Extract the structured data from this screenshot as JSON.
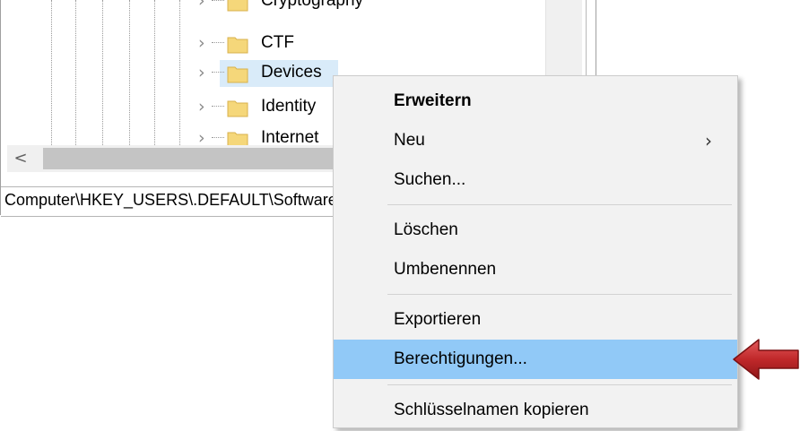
{
  "tree": {
    "items": [
      {
        "label": "Cryptography",
        "selected": false
      },
      {
        "label": "CTF",
        "selected": false
      },
      {
        "label": "Devices",
        "selected": true
      },
      {
        "label": "Identity",
        "selected": false
      },
      {
        "label": "Internet",
        "selected": false
      }
    ],
    "expand_icon": "chevron-right-icon",
    "folder_icon": "folder-icon"
  },
  "scrollbar": {
    "left_arrow": "<"
  },
  "statusbar": {
    "path": "Computer\\HKEY_USERS\\.DEFAULT\\Software\\Microsoft\\Devices"
  },
  "context_menu": {
    "items": [
      {
        "label": "Erweitern",
        "bold": true
      },
      {
        "label": "Neu",
        "submenu_arrow": "›"
      },
      {
        "label": "Suchen..."
      },
      {
        "label": "Löschen"
      },
      {
        "label": "Umbenennen"
      },
      {
        "label": "Exportieren"
      },
      {
        "label": "Berechtigungen...",
        "highlighted": true
      },
      {
        "label": "Schlüsselnamen kopieren"
      }
    ]
  },
  "colors": {
    "menu_background": "#f2f2f2",
    "menu_highlight": "#91c9f7",
    "tree_selection": "#d9ebf9",
    "folder": "#f5d77a",
    "annotation_arrow": "#c0282a"
  }
}
